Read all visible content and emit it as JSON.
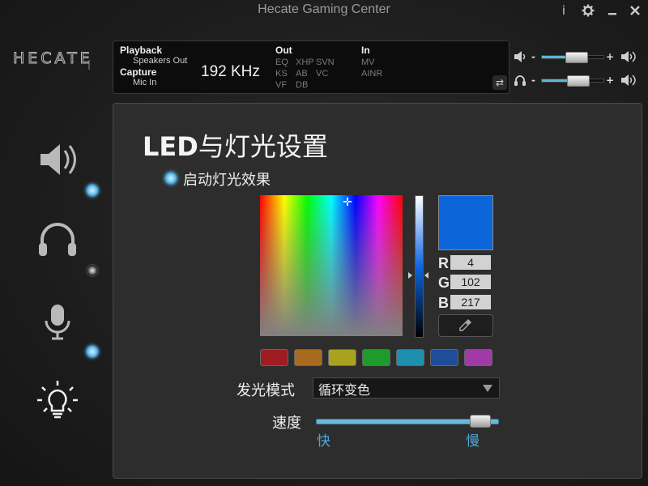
{
  "window": {
    "title": "Hecate Gaming Center",
    "info_icon": "i",
    "settings_icon": "gear-icon",
    "minimize_icon": "minimize-icon",
    "close_icon": "close-icon"
  },
  "logo": {
    "text": "HECATE"
  },
  "sidebar": {
    "items": [
      {
        "name": "speaker",
        "icon": "speaker-icon",
        "state": "active"
      },
      {
        "name": "headset",
        "icon": "headphones-icon",
        "state": "inactive"
      },
      {
        "name": "microphone",
        "icon": "microphone-icon",
        "state": "active"
      },
      {
        "name": "lighting",
        "icon": "bulb-icon",
        "state": "selected"
      }
    ]
  },
  "info": {
    "playback_label": "Playback",
    "playback_device": "Speakers Out",
    "capture_label": "Capture",
    "capture_device": "Mic In",
    "sample_rate": "192 KHz",
    "out_label": "Out",
    "out_row1": [
      "EQ",
      "XHP",
      "SVN"
    ],
    "out_row2": [
      "KS",
      "AB",
      "VC"
    ],
    "out_row3": [
      "VF",
      "DB"
    ],
    "in_label": "In",
    "in_row1": [
      "MV"
    ],
    "in_row2": [
      "AINR"
    ],
    "swap_icon": "swap-icon"
  },
  "volume": {
    "speaker": {
      "icon": "speaker-small-icon",
      "minus": "-",
      "plus": "+",
      "level": 0.58
    },
    "headphone": {
      "icon": "headphone-small-icon",
      "minus": "-",
      "plus": "+",
      "level": 0.62
    }
  },
  "main": {
    "title_latin": "LED",
    "title_cjk": "与灯光设置",
    "enable_label": "启动灯光效果",
    "color": {
      "hex": "#0d66d9",
      "r_label": "R",
      "g_label": "G",
      "b_label": "B",
      "r": "4",
      "g": "102",
      "b": "217"
    },
    "presets": [
      "#9e1c22",
      "#a86a1e",
      "#a9a21e",
      "#1f9a2c",
      "#1f8fb0",
      "#1e4d9a",
      "#a13aa8"
    ],
    "mode_label": "发光模式",
    "mode_value": "循环变色",
    "speed_label": "速度",
    "speed_fast": "快",
    "speed_slow": "慢",
    "speed_level": 0.95
  }
}
